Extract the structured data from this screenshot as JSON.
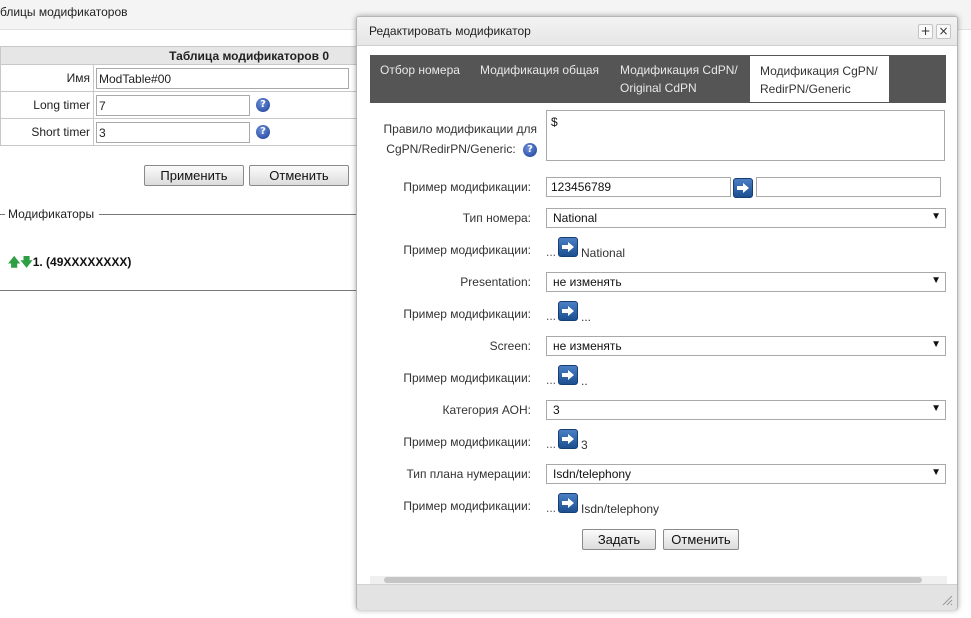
{
  "page": {
    "title": "блицы модификаторов",
    "table": {
      "header": "Таблица модификаторов 0",
      "rows": [
        {
          "label": "Имя",
          "value": "ModTable#00"
        },
        {
          "label": "Long timer",
          "value": "7"
        },
        {
          "label": "Short timer",
          "value": "3"
        }
      ]
    },
    "apply_label": "Применить",
    "cancel_label": "Отменить",
    "modifiers_legend": "Модификаторы",
    "modifier_item": {
      "index": "1.",
      "pattern": "(49XXXXXXXX)"
    }
  },
  "modal": {
    "title": "Редактировать модификатор",
    "tabs": [
      {
        "label": "Отбор номера",
        "active": false
      },
      {
        "label": "Модификация общая",
        "active": false
      },
      {
        "label": "Модификация CdPN/ Original CdPN",
        "active": false
      },
      {
        "label": "Модификация CgPN/ RedirPN/Generic",
        "active": true
      }
    ],
    "rule": {
      "label": "Правило модификации для CgPN/RedirPN/Generic:",
      "value": "$"
    },
    "example_label": "Пример модификации:",
    "example_number": {
      "input": "123456789",
      "output": ""
    },
    "number_type": {
      "label": "Тип номера:",
      "value": "National",
      "example": "National"
    },
    "presentation": {
      "label": "Presentation:",
      "value": "не изменять",
      "example": "..."
    },
    "screen": {
      "label": "Screen:",
      "value": "не изменять",
      "example": ".."
    },
    "aon_category": {
      "label": "Категория АОН:",
      "value": "3",
      "example": "3"
    },
    "numbering_plan": {
      "label": "Тип плана нумерации:",
      "value": "Isdn/telephony",
      "example": "Isdn/telephony"
    },
    "ellipsis": "...",
    "set_label": "Задать",
    "cancel_label": "Отменить"
  },
  "icons": [
    "help-icon",
    "arrow-right-icon",
    "arrow-up-icon",
    "arrow-down-icon",
    "plus-icon",
    "close-icon",
    "resize-grip-icon",
    "chevron-down-icon"
  ],
  "colors": {
    "tabs_bg": "#555555",
    "go_button": "#2a5ea8",
    "arrows": "#2ea043",
    "help": "#1c3f9c"
  }
}
